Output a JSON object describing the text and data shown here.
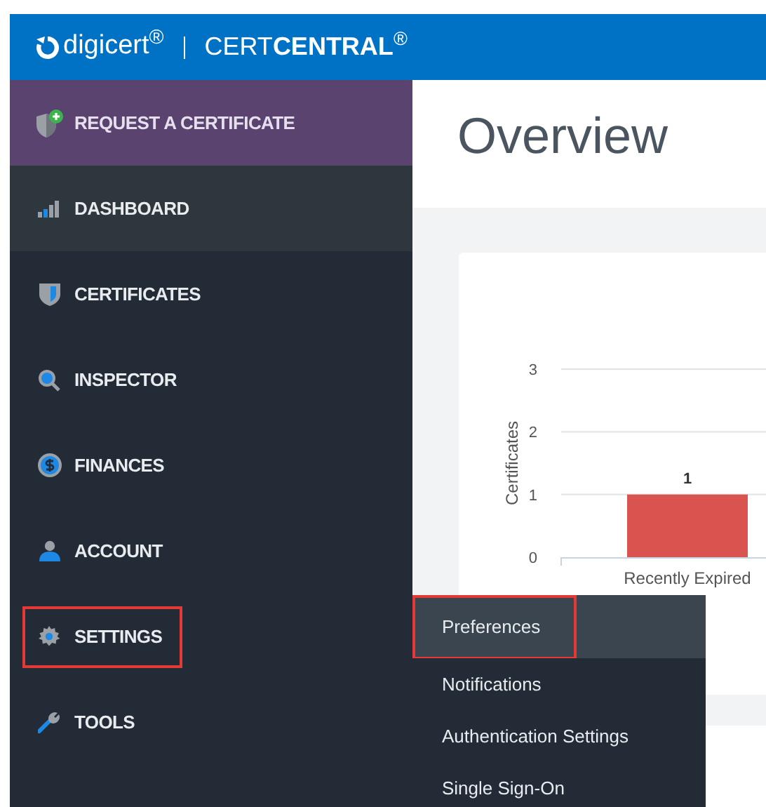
{
  "header": {
    "brand": "digicert$^{®}$",
    "product": "CERT**CENTRAL**$^{®}$"
  },
  "sidebar": {
    "items": [
      {
        "label": "REQUEST A CERTIFICATE",
        "kind": "action",
        "highlighted": false
      },
      {
        "label": "DASHBOARD",
        "kind": "link",
        "selected": true,
        "highlighted": false
      },
      {
        "label": "CERTIFICATES",
        "kind": "link",
        "selected": false,
        "highlighted": false
      },
      {
        "label": "INSPECTOR",
        "kind": "link",
        "selected": false,
        "highlighted": false
      },
      {
        "label": "FINANCES",
        "kind": "link",
        "selected": false,
        "highlighted": false
      },
      {
        "label": "ACCOUNT",
        "kind": "link",
        "selected": false,
        "highlighted": false
      },
      {
        "label": "SETTINGS",
        "kind": "link",
        "selected": false,
        "highlighted": true
      },
      {
        "label": "TOOLS",
        "kind": "link",
        "selected": false,
        "highlighted": false
      }
    ]
  },
  "main": {
    "title": "Overview",
    "chart_data": {
      "type": "bar",
      "ylabel": "Certificates",
      "categories": [
        "Recently Expired"
      ],
      "values": [
        1
      ],
      "ylim": [
        0,
        3
      ],
      "yticks": [
        0,
        1,
        2,
        3
      ],
      "data_labels": true
    }
  },
  "settings_menu": {
    "items": [
      {
        "label": "Preferences",
        "selected": true,
        "highlighted": true
      },
      {
        "label": "Notifications",
        "selected": false,
        "highlighted": false
      },
      {
        "label": "Authentication Settings",
        "selected": false,
        "highlighted": false
      },
      {
        "label": "Single Sign-On",
        "selected": false,
        "highlighted": false
      }
    ]
  }
}
